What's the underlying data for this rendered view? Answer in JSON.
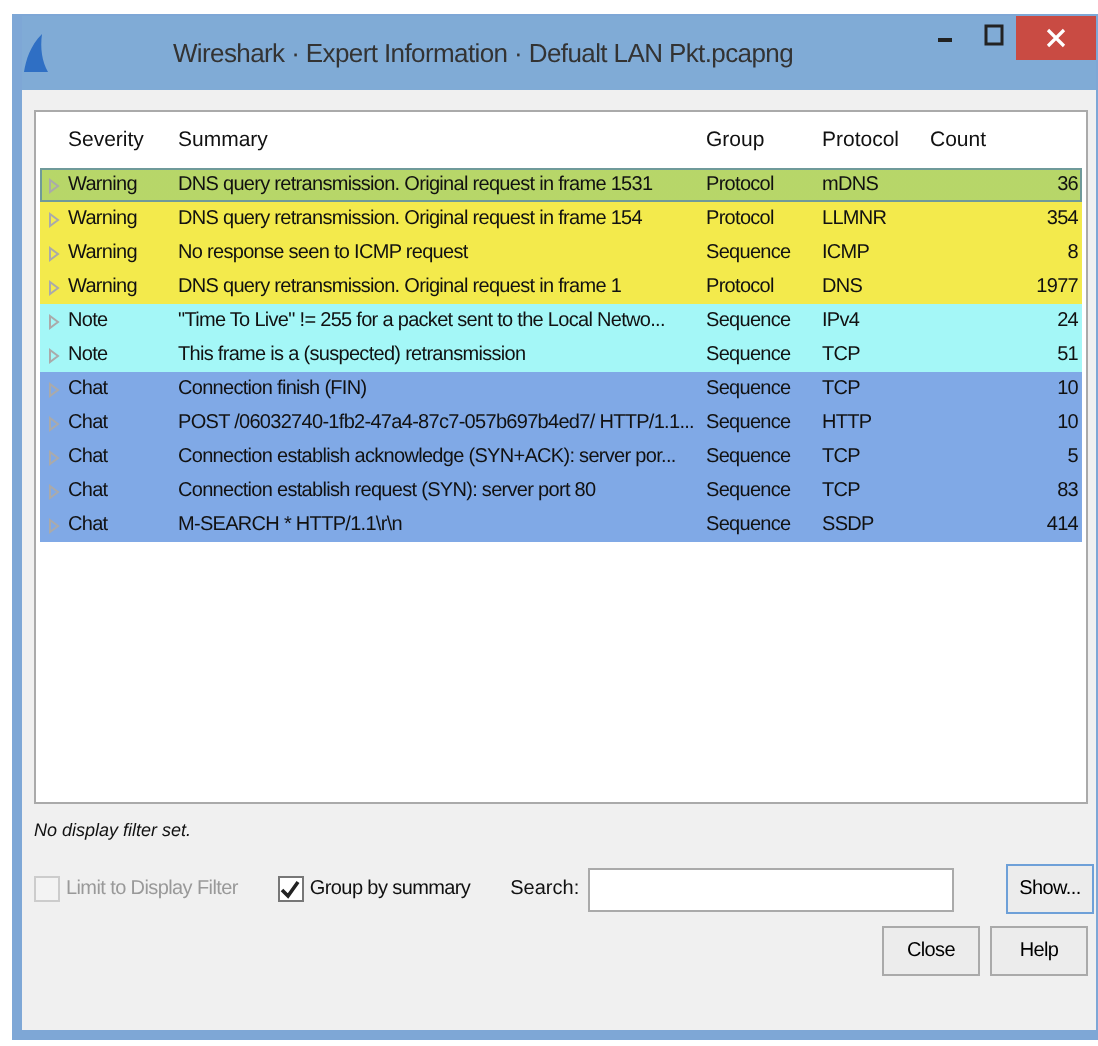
{
  "window": {
    "title": "Wireshark · Expert Information · Defualt LAN Pkt.pcapng"
  },
  "table": {
    "columns": [
      "Severity",
      "Summary",
      "Group",
      "Protocol",
      "Count"
    ],
    "rows": [
      {
        "kind": "warning",
        "selected": true,
        "severity": "Warning",
        "summary": "DNS query retransmission. Original request in frame 1531",
        "group": "Protocol",
        "protocol": "mDNS",
        "count": "36"
      },
      {
        "kind": "warning",
        "selected": false,
        "severity": "Warning",
        "summary": "DNS query retransmission. Original request in frame 154",
        "group": "Protocol",
        "protocol": "LLMNR",
        "count": "354"
      },
      {
        "kind": "warning",
        "selected": false,
        "severity": "Warning",
        "summary": "No response seen to ICMP request",
        "group": "Sequence",
        "protocol": "ICMP",
        "count": "8"
      },
      {
        "kind": "warning",
        "selected": false,
        "severity": "Warning",
        "summary": "DNS query retransmission. Original request in frame 1",
        "group": "Protocol",
        "protocol": "DNS",
        "count": "1977"
      },
      {
        "kind": "note",
        "selected": false,
        "severity": "Note",
        "summary": "\"Time To Live\" != 255 for a packet sent to the Local Netwo...",
        "group": "Sequence",
        "protocol": "IPv4",
        "count": "24"
      },
      {
        "kind": "note",
        "selected": false,
        "severity": "Note",
        "summary": "This frame is a (suspected) retransmission",
        "group": "Sequence",
        "protocol": "TCP",
        "count": "51"
      },
      {
        "kind": "chat",
        "selected": false,
        "severity": "Chat",
        "summary": "Connection finish (FIN)",
        "group": "Sequence",
        "protocol": "TCP",
        "count": "10"
      },
      {
        "kind": "chat",
        "selected": false,
        "severity": "Chat",
        "summary": "POST /06032740-1fb2-47a4-87c7-057b697b4ed7/ HTTP/1.1...",
        "group": "Sequence",
        "protocol": "HTTP",
        "count": "10"
      },
      {
        "kind": "chat",
        "selected": false,
        "severity": "Chat",
        "summary": "Connection establish acknowledge (SYN+ACK): server por...",
        "group": "Sequence",
        "protocol": "TCP",
        "count": "5"
      },
      {
        "kind": "chat",
        "selected": false,
        "severity": "Chat",
        "summary": "Connection establish request (SYN): server port 80",
        "group": "Sequence",
        "protocol": "TCP",
        "count": "83"
      },
      {
        "kind": "chat",
        "selected": false,
        "severity": "Chat",
        "summary": "M-SEARCH * HTTP/1.1\\r\\n",
        "group": "Sequence",
        "protocol": "SSDP",
        "count": "414"
      }
    ]
  },
  "filter_status": "No display filter set.",
  "limit_to_display_filter": {
    "label": "Limit to Display Filter",
    "checked": false,
    "disabled": true
  },
  "group_by_summary": {
    "label": "Group by summary",
    "checked": true
  },
  "search": {
    "label": "Search:"
  },
  "buttons": {
    "show": "Show...",
    "close": "Close",
    "help": "Help"
  }
}
